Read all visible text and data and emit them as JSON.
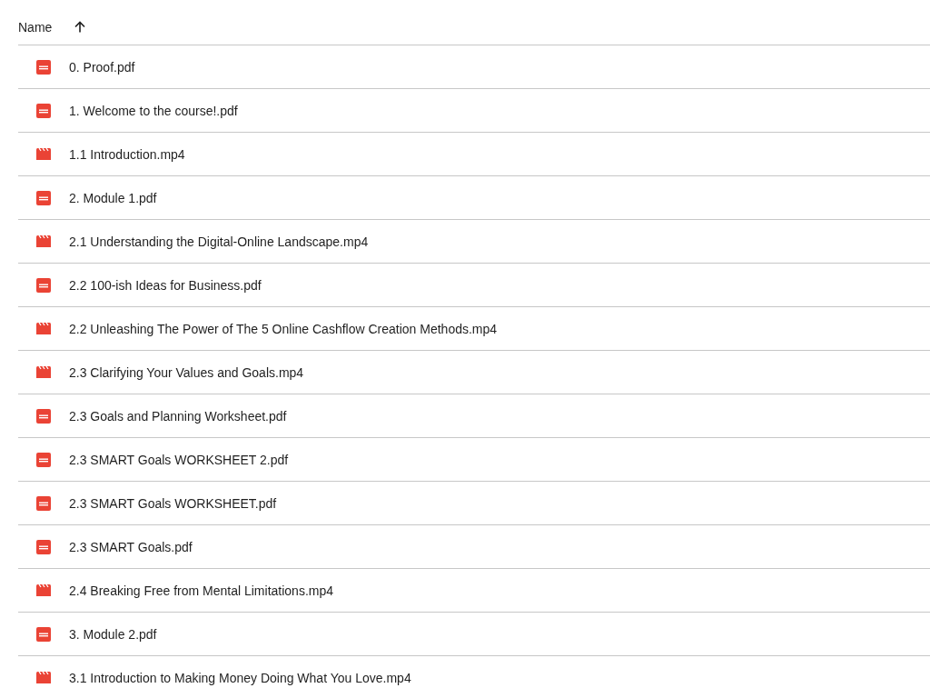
{
  "header": {
    "label": "Name",
    "ascending": true
  },
  "files": [
    {
      "name": "0. Proof.pdf",
      "kind": "pdf"
    },
    {
      "name": "1. Welcome to the course!.pdf",
      "kind": "pdf"
    },
    {
      "name": "1.1 Introduction.mp4",
      "kind": "video"
    },
    {
      "name": "2. Module 1.pdf",
      "kind": "pdf"
    },
    {
      "name": "2.1 Understanding the Digital-Online Landscape.mp4",
      "kind": "video"
    },
    {
      "name": "2.2 100-ish Ideas for Business.pdf",
      "kind": "pdf"
    },
    {
      "name": "2.2 Unleashing The Power of The 5 Online Cashflow Creation Methods.mp4",
      "kind": "video"
    },
    {
      "name": "2.3 Clarifying Your Values and Goals.mp4",
      "kind": "video"
    },
    {
      "name": "2.3 Goals and Planning Worksheet.pdf",
      "kind": "pdf"
    },
    {
      "name": "2.3 SMART Goals WORKSHEET 2.pdf",
      "kind": "pdf"
    },
    {
      "name": "2.3 SMART Goals WORKSHEET.pdf",
      "kind": "pdf"
    },
    {
      "name": "2.3 SMART Goals.pdf",
      "kind": "pdf"
    },
    {
      "name": "2.4 Breaking Free from Mental Limitations.mp4",
      "kind": "video"
    },
    {
      "name": "3. Module 2.pdf",
      "kind": "pdf"
    },
    {
      "name": "3.1 Introduction to Making Money Doing What You Love.mp4",
      "kind": "video"
    }
  ]
}
